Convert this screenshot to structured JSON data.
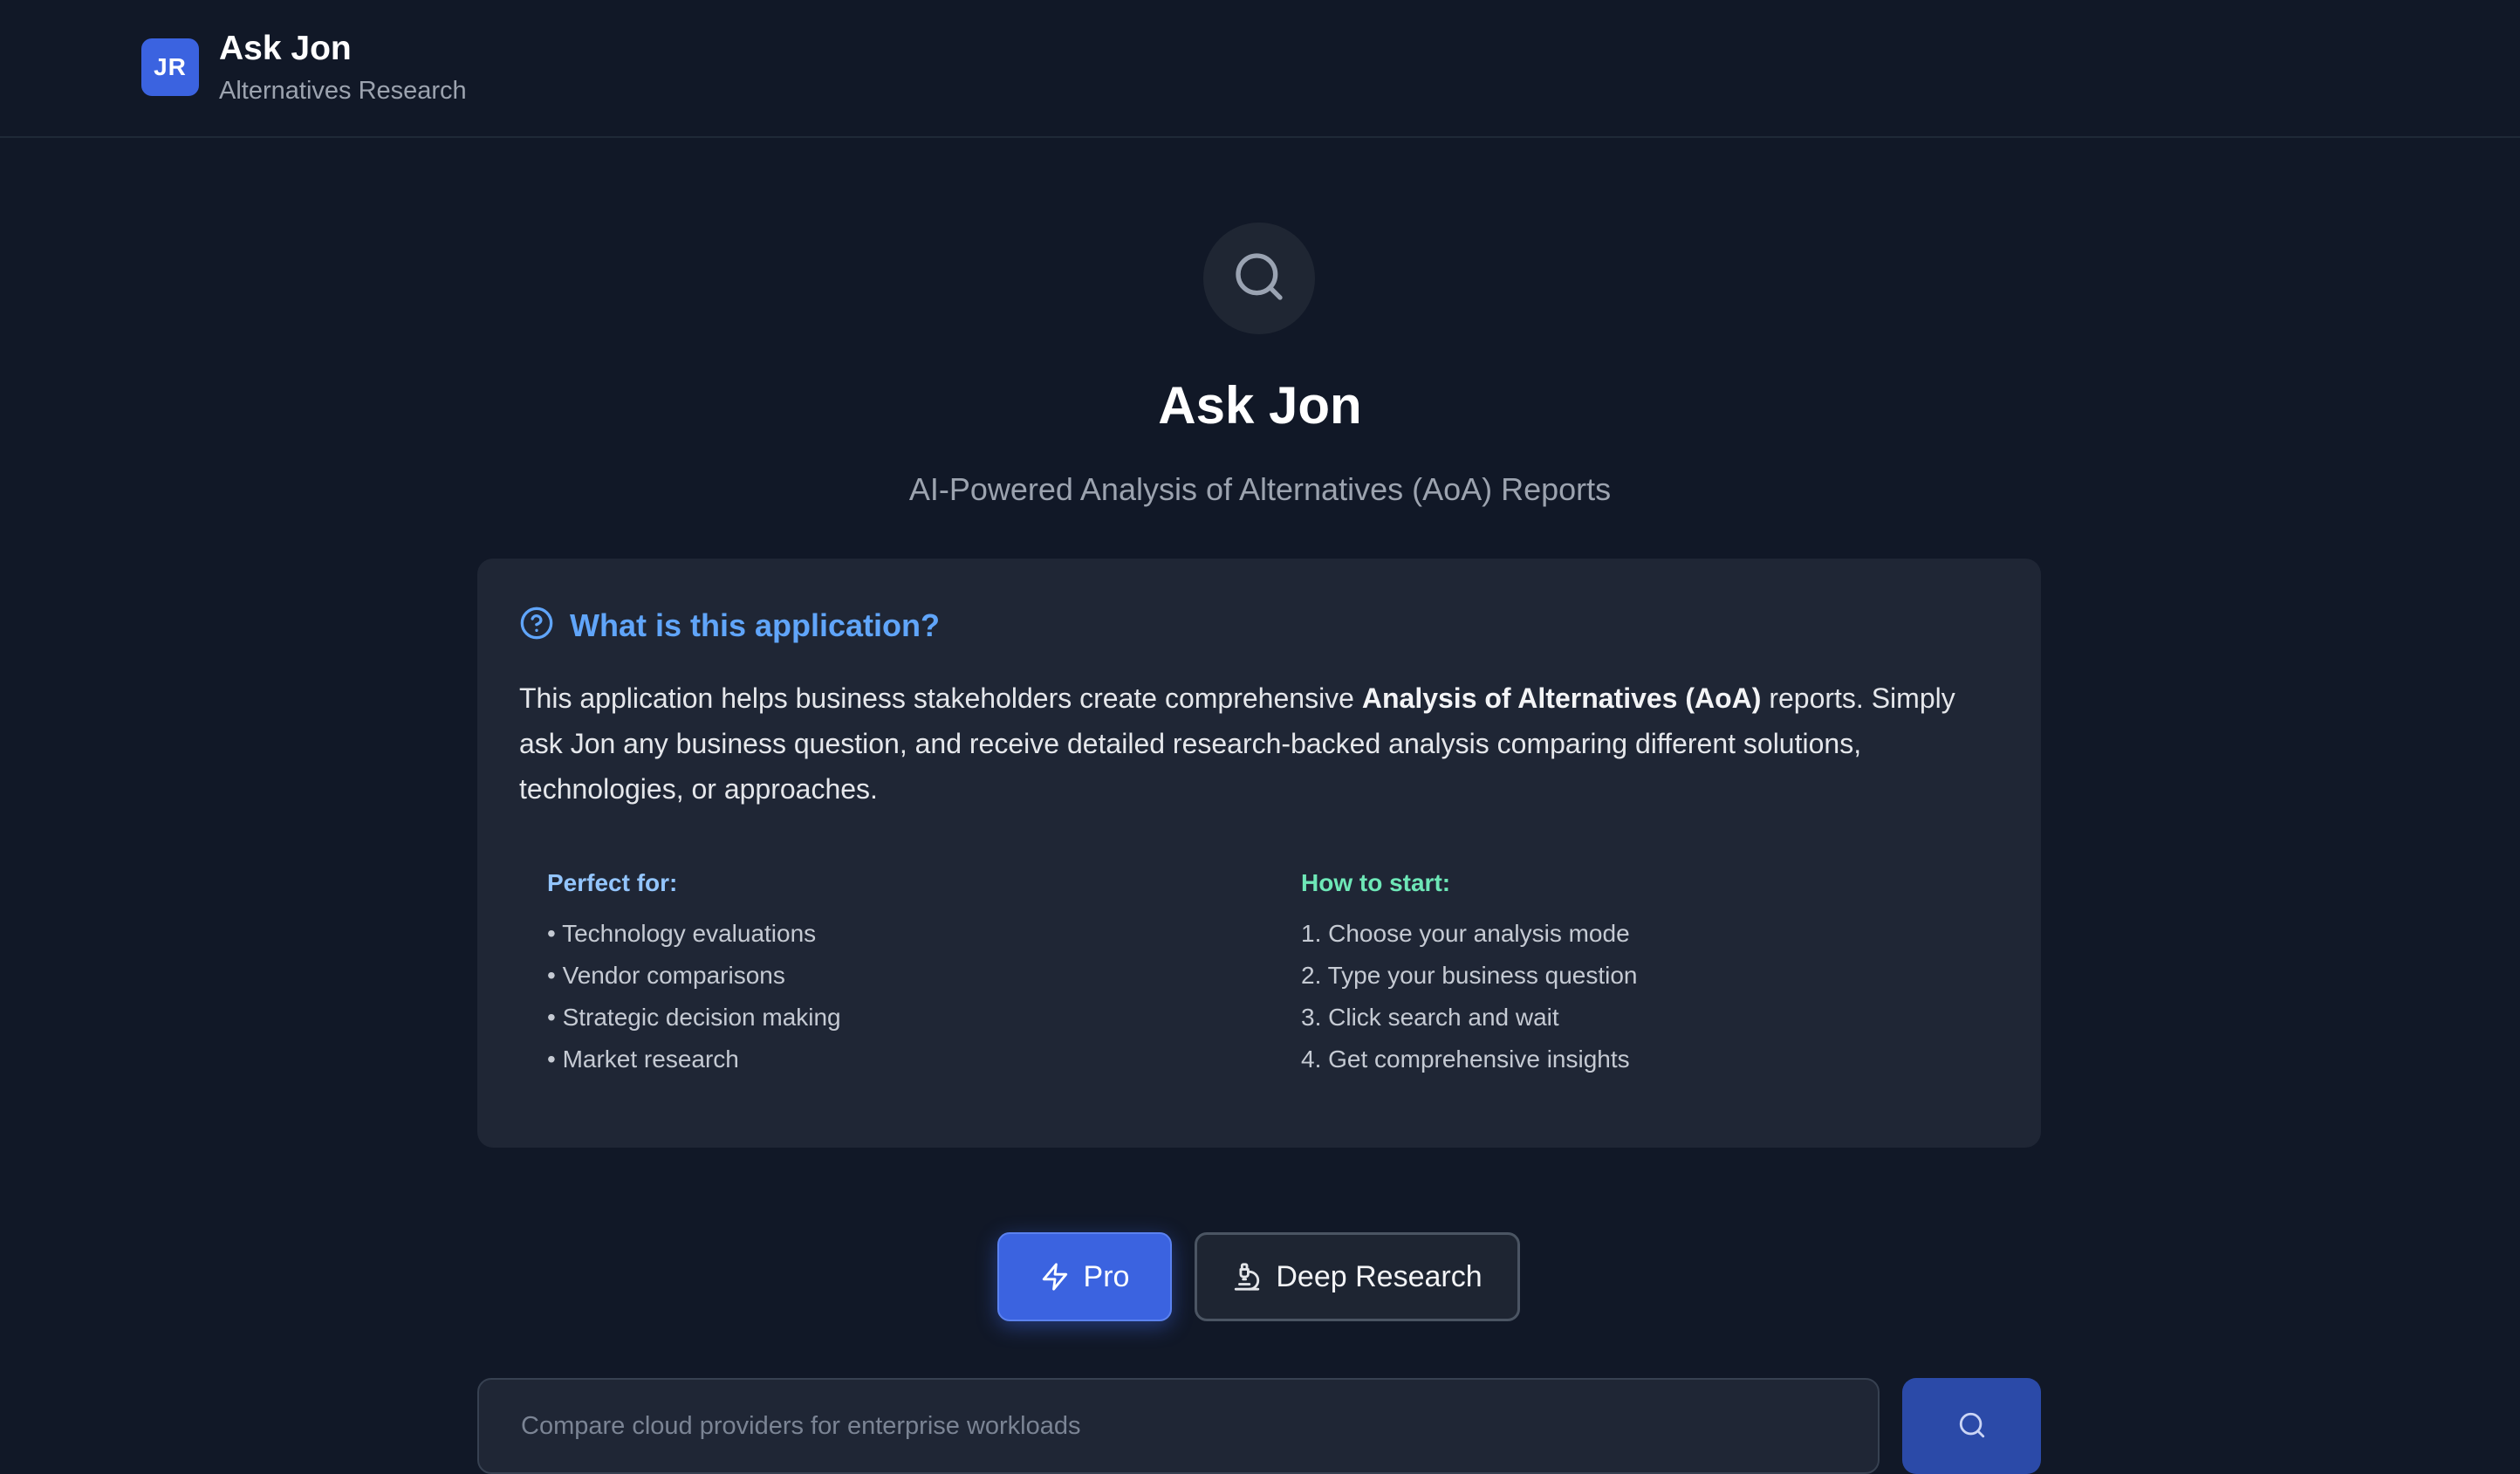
{
  "header": {
    "logo_initials": "JR",
    "title": "Ask Jon",
    "subtitle": "Alternatives Research"
  },
  "hero": {
    "icon": "search-icon",
    "title": "Ask Jon",
    "subtitle": "AI-Powered Analysis of Alternatives (AoA) Reports"
  },
  "info": {
    "icon": "help-circle-icon",
    "title": "What is this application?",
    "body_prefix": "This application helps business stakeholders create comprehensive ",
    "body_bold": "Analysis of Alternatives (AoA)",
    "body_suffix": " reports. Simply ask Jon any business question, and receive detailed research-backed analysis comparing different solutions, technologies, or approaches.",
    "perfect_for": {
      "title": "Perfect for:",
      "items": [
        "• Technology evaluations",
        "• Vendor comparisons",
        "• Strategic decision making",
        "• Market research"
      ]
    },
    "how_to_start": {
      "title": "How to start:",
      "items": [
        "1. Choose your analysis mode",
        "2. Type your business question",
        "3. Click search and wait",
        "4. Get comprehensive insights"
      ]
    }
  },
  "modes": {
    "pro_label": "Pro",
    "pro_icon": "lightning-icon",
    "deep_label": "Deep Research",
    "deep_icon": "microscope-icon",
    "selected": "Pro"
  },
  "search": {
    "placeholder": "Compare cloud providers for enterprise workloads",
    "value": "",
    "button_icon": "search-icon"
  },
  "colors": {
    "background": "#111827",
    "accent": "#3b63e0",
    "card": "#1f2635",
    "info_title": "#60a5fa",
    "perfect_for_title": "#93c5fd",
    "how_to_start_title": "#6ee7b7"
  }
}
